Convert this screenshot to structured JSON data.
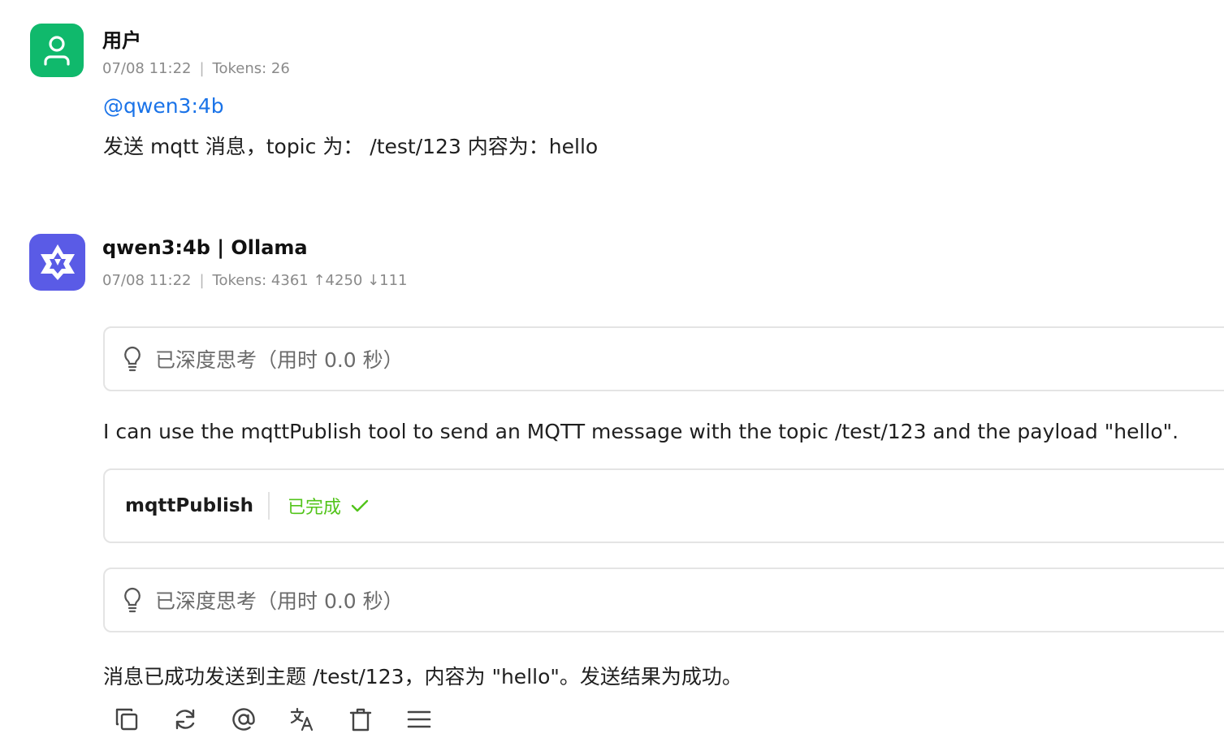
{
  "user_message": {
    "name": "用户",
    "time": "07/08 11:22",
    "separator": "|",
    "tokens": "Tokens: 26",
    "mention": "@qwen3:4b",
    "text": "发送 mqtt 消息，topic 为：  /test/123 内容为：hello",
    "avatar_color": "#10b96c",
    "avatar_icon": "user-icon"
  },
  "bot_message": {
    "name": "qwen3:4b | Ollama",
    "time": "07/08 11:22",
    "separator": "|",
    "tokens": "Tokens: 4361 ↑4250 ↓111",
    "avatar_color": "#5a5be6",
    "avatar_icon": "qwen-logo-icon",
    "thinking_1": "已深度思考（用时 0.0 秒）",
    "intro_text": "I can use the mqttPublish tool to send an MQTT message with the topic /test/123 and the payload \"hello\".",
    "tool_name": "mqttPublish",
    "tool_status": "已完成",
    "tool_status_color": "#52c41a",
    "thinking_2": "已深度思考（用时 0.0 秒）",
    "result_text": "消息已成功发送到主题 /test/123，内容为 \"hello\"。发送结果为成功。"
  },
  "actions": [
    "copy-icon",
    "regenerate-icon",
    "mention-icon",
    "translate-icon",
    "delete-icon",
    "menu-icon"
  ]
}
